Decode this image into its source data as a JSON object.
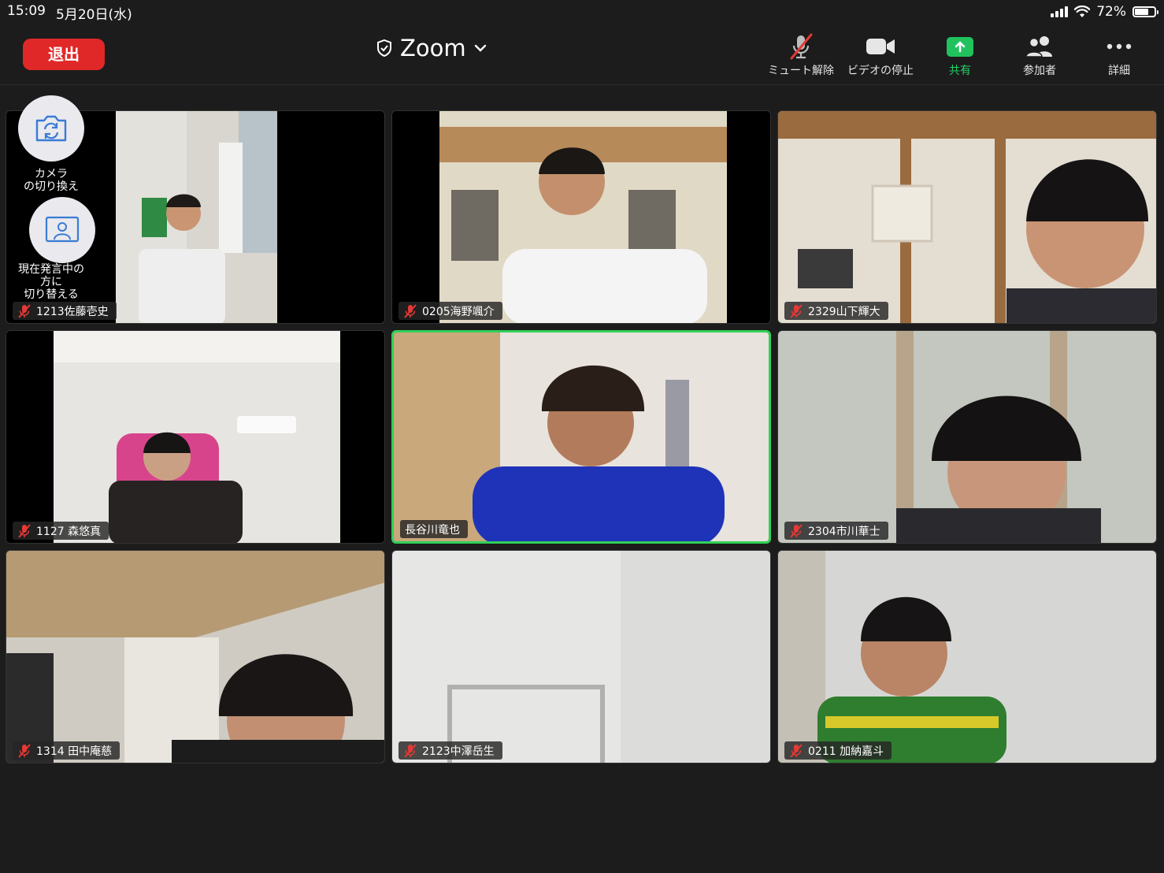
{
  "status_bar": {
    "time": "15:09",
    "date": "5月20日(水)",
    "battery": "72%",
    "battery_level": 0.72
  },
  "toolbar": {
    "leave_label": "退出",
    "title": "Zoom",
    "mute_label": "ミュート解除",
    "video_label": "ビデオの停止",
    "share_label": "共有",
    "participants_label": "参加者",
    "more_label": "詳細"
  },
  "controls": {
    "switch_camera_label": "カメラ\nの切り換え",
    "switch_speaker_label": "現在発言中の\n方に\n切り替える"
  },
  "participants": [
    {
      "name": "1213佐藤壱史",
      "muted": true,
      "active": false
    },
    {
      "name": "0205海野颯介",
      "muted": true,
      "active": false
    },
    {
      "name": "2329山下輝大",
      "muted": true,
      "active": false
    },
    {
      "name": "1127  森悠真",
      "muted": true,
      "active": false
    },
    {
      "name": "長谷川竜也",
      "muted": false,
      "active": true
    },
    {
      "name": "2304市川華士",
      "muted": true,
      "active": false
    },
    {
      "name": "1314 田中庵慈",
      "muted": true,
      "active": false
    },
    {
      "name": "2123中澤岳生",
      "muted": true,
      "active": false
    },
    {
      "name": "0211 加納嘉斗",
      "muted": true,
      "active": false
    }
  ],
  "colors": {
    "accent_green": "#30d158",
    "leave_red": "#e02828",
    "muted_red": "#e53935"
  }
}
